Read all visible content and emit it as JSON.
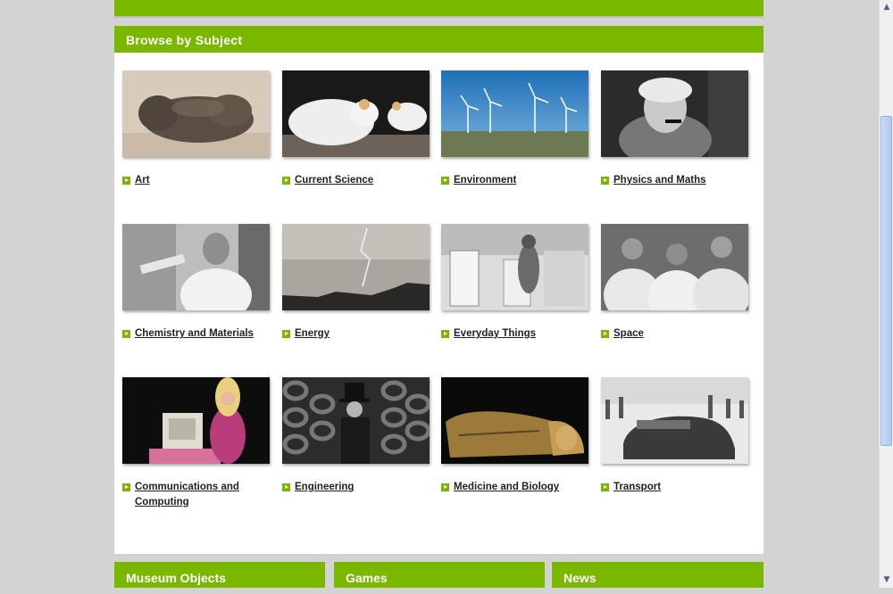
{
  "browse": {
    "title": "Browse by Subject",
    "subjects": [
      {
        "label": "Art"
      },
      {
        "label": "Current Science"
      },
      {
        "label": "Environment"
      },
      {
        "label": "Physics and Maths"
      },
      {
        "label": "Chemistry and Materials"
      },
      {
        "label": "Energy"
      },
      {
        "label": "Everyday Things"
      },
      {
        "label": "Space"
      },
      {
        "label": "Communications and Computing"
      },
      {
        "label": "Engineering"
      },
      {
        "label": "Medicine and Biology"
      },
      {
        "label": "Transport"
      }
    ]
  },
  "bottom_panels": [
    {
      "title": "Museum Objects"
    },
    {
      "title": "Games"
    },
    {
      "title": "News"
    }
  ],
  "colors": {
    "accent": "#7ab800",
    "background": "#d3d3d3"
  },
  "scrollbar": {
    "up_icon": "arrow-up-icon",
    "down_icon": "arrow-down-icon"
  }
}
